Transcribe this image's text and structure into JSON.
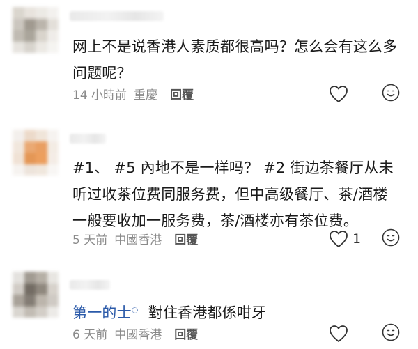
{
  "comments": [
    {
      "text": "网上不是说香港人素质都很高吗？怎么会有这么多问题呢？",
      "time": "14 小時前",
      "location": "重慶",
      "reply_label": "回覆",
      "likes": ""
    },
    {
      "text": "#1、 #5 內地不是一样吗？ #2 街边茶餐厅从未听过收茶位费同服务费，但中高级餐厅、茶/酒楼一般要收加一服务费，茶/酒楼亦有茶位费。",
      "time": "5 天前",
      "location": "中國香港",
      "reply_label": "回覆",
      "likes": "1"
    },
    {
      "mention": "第一的士",
      "text": "對住香港都係咁牙",
      "time": "6 天前",
      "location": "中國香港",
      "reply_label": "回覆",
      "likes": ""
    }
  ],
  "icons": {
    "like": "heart-outline-icon",
    "reaction": "smiley-face-icon",
    "mention_mark": "mention-icon"
  },
  "colors": {
    "text": "#1a1a1a",
    "meta": "#8a8a8a",
    "mention": "#2b5aa9"
  }
}
